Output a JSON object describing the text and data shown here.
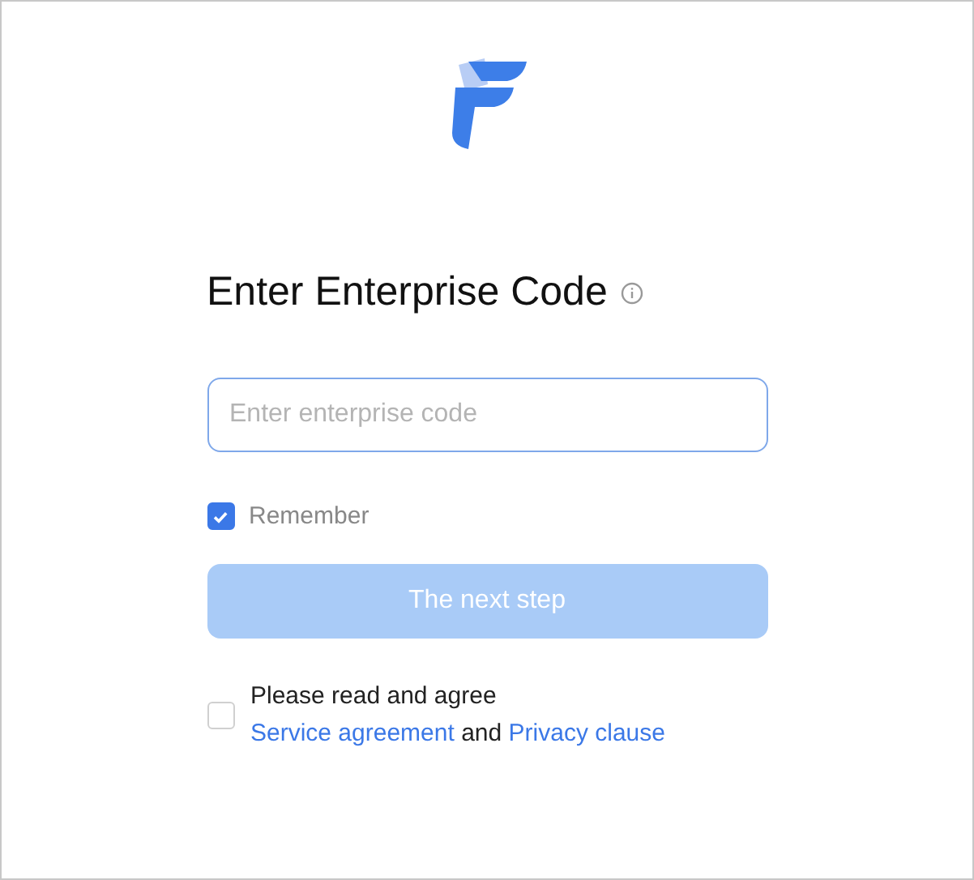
{
  "title": "Enter Enterprise Code",
  "code_field": {
    "placeholder": "Enter enterprise code"
  },
  "remember": {
    "label": "Remember",
    "checked": true
  },
  "next_button": {
    "label": "The next step",
    "disabled": true
  },
  "agreement": {
    "checked": false,
    "prompt": "Please read and agree",
    "link_1": "Service agreement",
    "conjunction": "and",
    "link_2": "Privacy clause"
  }
}
